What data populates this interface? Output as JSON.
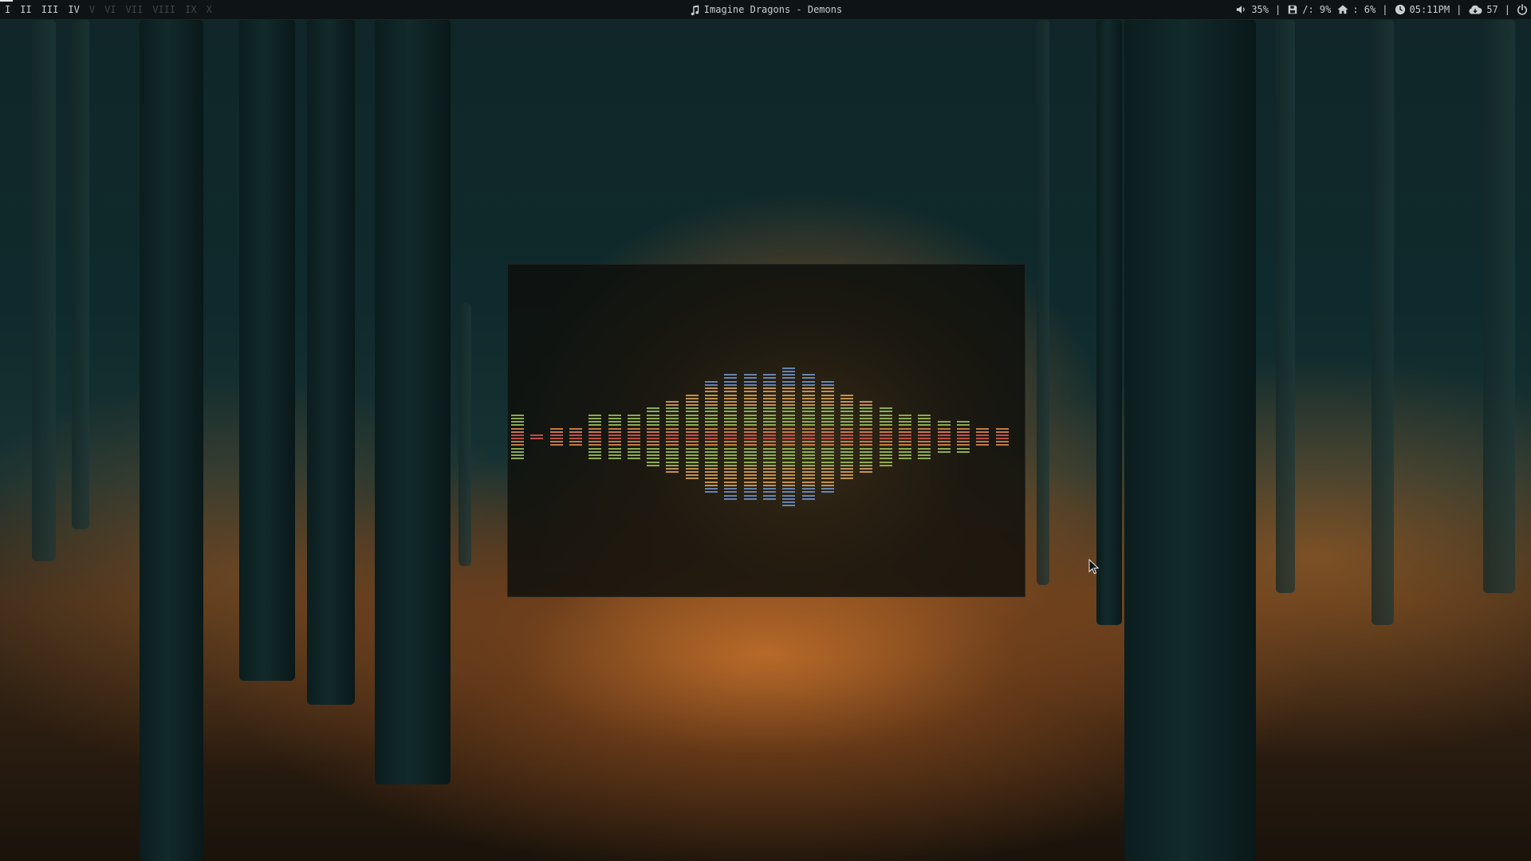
{
  "topbar": {
    "workspaces": [
      {
        "label": "I",
        "state": "active"
      },
      {
        "label": "II",
        "state": "occupied"
      },
      {
        "label": "III",
        "state": "occupied"
      },
      {
        "label": "IV",
        "state": "occupied"
      },
      {
        "label": "V",
        "state": "empty"
      },
      {
        "label": "VI",
        "state": "empty"
      },
      {
        "label": "VII",
        "state": "empty"
      },
      {
        "label": "VIII",
        "state": "empty"
      },
      {
        "label": "IX",
        "state": "empty"
      },
      {
        "label": "X",
        "state": "empty"
      }
    ],
    "now_playing": {
      "icon": "music-note-icon",
      "text": "Imagine Dragons - Demons"
    },
    "status": {
      "volume": {
        "icon": "speaker-icon",
        "text": "35%"
      },
      "disk_root": {
        "icon": "floppy-disk-icon",
        "text": "/: 9%"
      },
      "disk_home": {
        "icon": "home-icon",
        "text": ": 6%"
      },
      "clock": {
        "icon": "clock-icon",
        "text": "05:11PM"
      },
      "weather": {
        "icon": "cloud-icon",
        "text": "57"
      },
      "power": {
        "icon": "power-icon"
      },
      "separator": "|"
    }
  },
  "visualizer": {
    "columns_levels": [
      3,
      0,
      1,
      1,
      3,
      3,
      3,
      4,
      5,
      6,
      8,
      9,
      9,
      9,
      10,
      9,
      8,
      6,
      5,
      4,
      3,
      3,
      2,
      2,
      1,
      1
    ],
    "colors": {
      "center": "#d9564f",
      "inner": "#d98a4a",
      "mid": "#9cc15a",
      "outer": "#d9a25a",
      "top": "#6f93c9"
    }
  },
  "colors": {
    "topbar_bg": "#0e1415",
    "topbar_text": "#c9cfcf",
    "workspace_empty": "#3d4647"
  }
}
